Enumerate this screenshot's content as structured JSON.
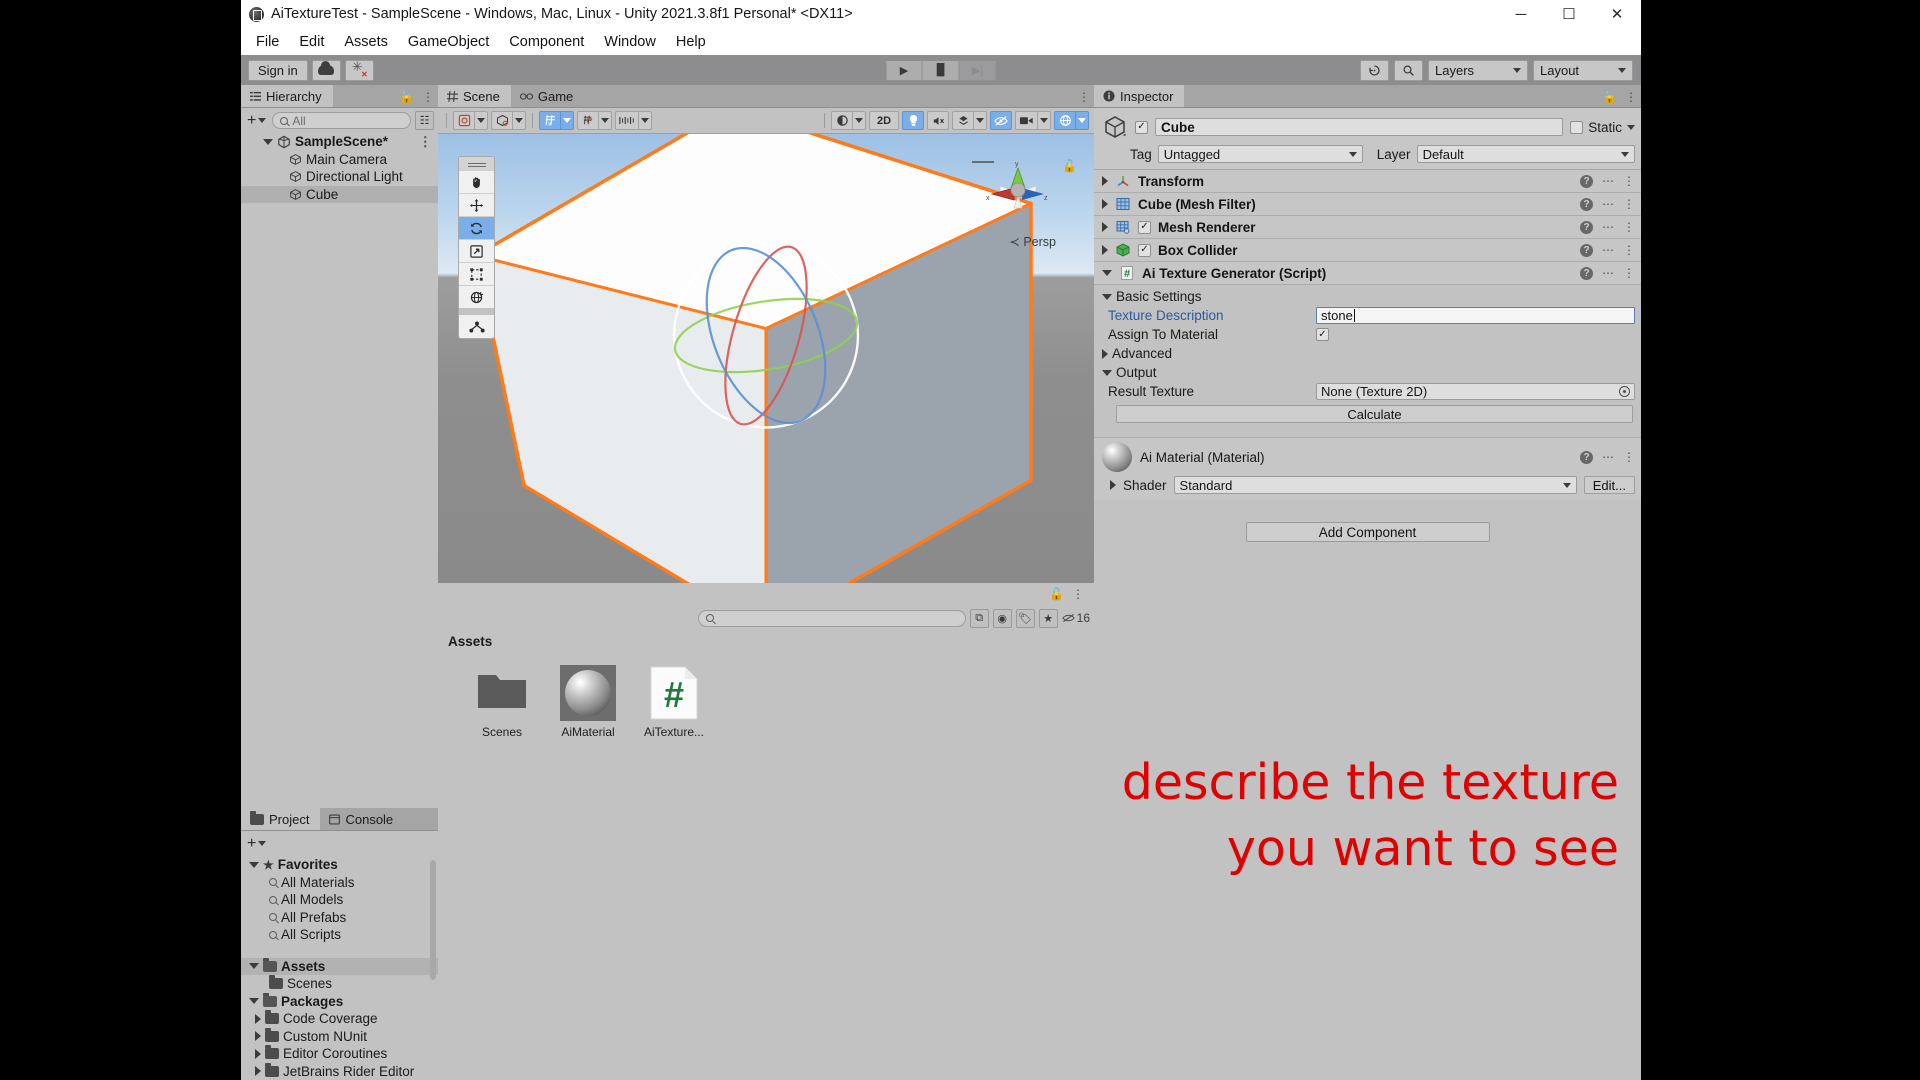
{
  "window": {
    "title": "AiTextureTest - SampleScene - Windows, Mac, Linux - Unity 2021.3.8f1 Personal* <DX11>",
    "minimize": "─",
    "maximize": "☐",
    "close": "✕"
  },
  "menubar": {
    "items": [
      "File",
      "Edit",
      "Assets",
      "GameObject",
      "Component",
      "Window",
      "Help"
    ]
  },
  "toolbar": {
    "sign_in": "Sign in",
    "cloud_icon": "cloud-icon",
    "bug_icon": "bug-report-icon",
    "play": "▶",
    "pause": "▐▌",
    "step": "▶|",
    "history_icon": "undo-history-icon",
    "search_icon": "search-icon",
    "layers": "Layers",
    "layout": "Layout"
  },
  "hierarchy": {
    "tab": "Hierarchy",
    "search_placeholder": "All",
    "create_label": "+",
    "items": [
      {
        "label": "SampleScene*",
        "depth": 0,
        "selected": false,
        "bold": true,
        "expanded": true
      },
      {
        "label": "Main Camera",
        "depth": 1,
        "selected": false,
        "bold": false
      },
      {
        "label": "Directional Light",
        "depth": 1,
        "selected": false,
        "bold": false
      },
      {
        "label": "Cube",
        "depth": 1,
        "selected": true,
        "bold": false
      }
    ]
  },
  "scene": {
    "tabs": [
      {
        "label": "Scene",
        "active": true,
        "icon": "grid-icon"
      },
      {
        "label": "Game",
        "active": false,
        "icon": "gamepad-icon"
      }
    ],
    "toolbar": {
      "draw_mode": "shaded-mode-icon",
      "gizmo_2d_mode": "2d-icon",
      "two_d_label": "2D",
      "lighting": "lighting-icon",
      "audio": "audio-mute-icon",
      "fx": "effects-icon",
      "scene_vis": "scene-visibility-icon",
      "camera": "scene-camera-icon",
      "gizmos": "gizmos-icon"
    },
    "tools": [
      {
        "name": "hand-tool",
        "glyph": "✋",
        "active": false
      },
      {
        "name": "move-tool",
        "glyph": "✥",
        "active": false
      },
      {
        "name": "rotate-tool",
        "glyph": "↻",
        "active": true
      },
      {
        "name": "scale-tool",
        "glyph": "⤡",
        "active": false
      },
      {
        "name": "rect-tool",
        "glyph": "⬚",
        "active": false
      },
      {
        "name": "transform-tool",
        "glyph": "❂",
        "active": false
      },
      {
        "name": "custom-tool",
        "glyph": "⚙",
        "active": false
      }
    ],
    "persp_label": "Persp",
    "axis_x": "x",
    "axis_y": "y",
    "axis_z": "z"
  },
  "project": {
    "tabs": [
      {
        "label": "Project",
        "active": true
      },
      {
        "label": "Console",
        "active": false
      }
    ],
    "search_placeholder": "",
    "asset_count": "16",
    "tree": [
      {
        "label": "Favorites",
        "depth": 0,
        "kind": "star",
        "bold": true,
        "expanded": true
      },
      {
        "label": "All Materials",
        "depth": 1,
        "kind": "search"
      },
      {
        "label": "All Models",
        "depth": 1,
        "kind": "search"
      },
      {
        "label": "All Prefabs",
        "depth": 1,
        "kind": "search"
      },
      {
        "label": "All Scripts",
        "depth": 1,
        "kind": "search"
      },
      {
        "label": "",
        "depth": 0,
        "kind": "spacer"
      },
      {
        "label": "Assets",
        "depth": 0,
        "kind": "folder-open",
        "bold": true,
        "expanded": true,
        "selected": true
      },
      {
        "label": "Scenes",
        "depth": 1,
        "kind": "folder"
      },
      {
        "label": "Packages",
        "depth": 0,
        "kind": "folder-open",
        "bold": true,
        "expanded": true
      },
      {
        "label": "Code Coverage",
        "depth": 1,
        "kind": "folder",
        "collapsed": true
      },
      {
        "label": "Custom NUnit",
        "depth": 1,
        "kind": "folder",
        "collapsed": true
      },
      {
        "label": "Editor Coroutines",
        "depth": 1,
        "kind": "folder",
        "collapsed": true
      },
      {
        "label": "JetBrains Rider Editor",
        "depth": 1,
        "kind": "folder",
        "collapsed": true
      }
    ],
    "breadcrumb": "Assets",
    "assets": [
      {
        "label": "Scenes",
        "kind": "folder"
      },
      {
        "label": "AiMaterial",
        "kind": "material"
      },
      {
        "label": "AiTexture...",
        "kind": "csharp-script"
      }
    ]
  },
  "inspector": {
    "tab": "Inspector",
    "object_name": "Cube",
    "object_enabled": true,
    "static_label": "Static",
    "static_checked": false,
    "tag_label": "Tag",
    "tag_value": "Untagged",
    "layer_label": "Layer",
    "layer_value": "Default",
    "components": [
      {
        "name": "Transform",
        "icon": "transform-icon",
        "expanded": false,
        "has_toggle": false
      },
      {
        "name": "Cube (Mesh Filter)",
        "icon": "mesh-filter-icon",
        "expanded": false,
        "has_toggle": false
      },
      {
        "name": "Mesh Renderer",
        "icon": "mesh-renderer-icon",
        "expanded": false,
        "has_toggle": true,
        "enabled": true
      },
      {
        "name": "Box Collider",
        "icon": "box-collider-icon",
        "expanded": false,
        "has_toggle": true,
        "enabled": true
      },
      {
        "name": "Ai Texture Generator (Script)",
        "icon": "script-icon",
        "expanded": true,
        "has_toggle": false
      }
    ],
    "script": {
      "basic_settings": "Basic Settings",
      "texture_description_label": "Texture Description",
      "texture_description_value": "stone",
      "assign_to_material_label": "Assign To Material",
      "assign_to_material_checked": true,
      "advanced_label": "Advanced",
      "output_label": "Output",
      "result_texture_label": "Result Texture",
      "result_texture_value": "None (Texture 2D)",
      "calculate_button": "Calculate"
    },
    "material": {
      "title": "Ai Material (Material)",
      "shader_label": "Shader",
      "shader_value": "Standard",
      "edit_button": "Edit..."
    },
    "add_component": "Add Component"
  },
  "annotation": {
    "line1": "describe the texture",
    "line2": "you want to see",
    "color": "#e00000"
  }
}
